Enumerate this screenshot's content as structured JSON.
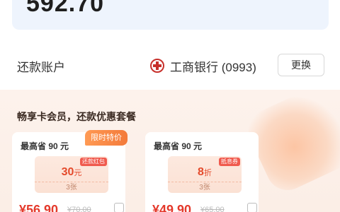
{
  "amount": {
    "value": "592.70"
  },
  "account": {
    "label": "还款账户",
    "bank_name": "工商银行 (0993)",
    "bank_icon": "icbc-logo-icon",
    "change_label": "更换"
  },
  "promo": {
    "title": "畅享卡会员，还款优惠套餐",
    "packages": [
      {
        "save": "最高省 90 元",
        "tag": "限时特价",
        "badge": "还款红包",
        "value": "30",
        "unit": "元",
        "count": "3张",
        "price": "¥56.90",
        "old_price": "¥70.00"
      },
      {
        "save": "最高省 90 元",
        "tag": "",
        "badge": "抵息券",
        "value": "8",
        "unit": "折",
        "count": "3张",
        "price": "¥49.90",
        "old_price": "¥65.00"
      }
    ]
  },
  "colors": {
    "accent": "#e4392b",
    "tag": "#f37a3a",
    "card_bg": "#eef4fd"
  }
}
